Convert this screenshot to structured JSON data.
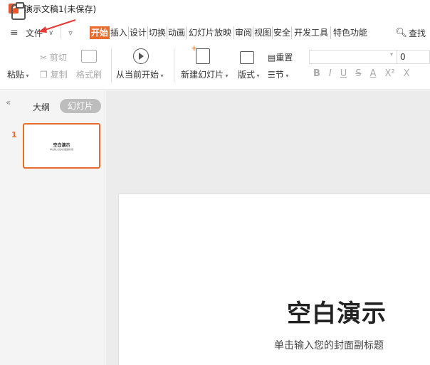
{
  "app": {
    "title": "演示文稿1(未保存)",
    "logo_letter": "P"
  },
  "menubar": {
    "menu_icon": "≡",
    "file_label": "文件",
    "tabs": [
      "开始",
      "插入",
      "设计",
      "切换",
      "动画",
      "幻灯片放映",
      "审阅",
      "视图",
      "安全",
      "开发工具",
      "特色功能"
    ],
    "active_tab": "开始",
    "search_label": "查找"
  },
  "ribbon": {
    "paste": "粘贴",
    "cut": "剪切",
    "copy": "复制",
    "format_painter": "格式刷",
    "from_current": "从当前开始",
    "new_slide": "新建幻灯片",
    "layout": "版式",
    "section": "节",
    "reset": "重置",
    "font_size": "0",
    "format_buttons": [
      "B",
      "I",
      "U",
      "S",
      "A",
      "X²",
      "X"
    ]
  },
  "left_panel": {
    "outline_tab": "大纲",
    "slides_tab": "幻灯片",
    "slide_number": "1",
    "thumb_title": "空白演示",
    "thumb_subtitle": "单击输入您的封面副标题"
  },
  "slide": {
    "title": "空白演示",
    "subtitle": "单击输入您的封面副标题"
  },
  "colors": {
    "accent": "#e86c2e",
    "arrow": "#e53935"
  }
}
